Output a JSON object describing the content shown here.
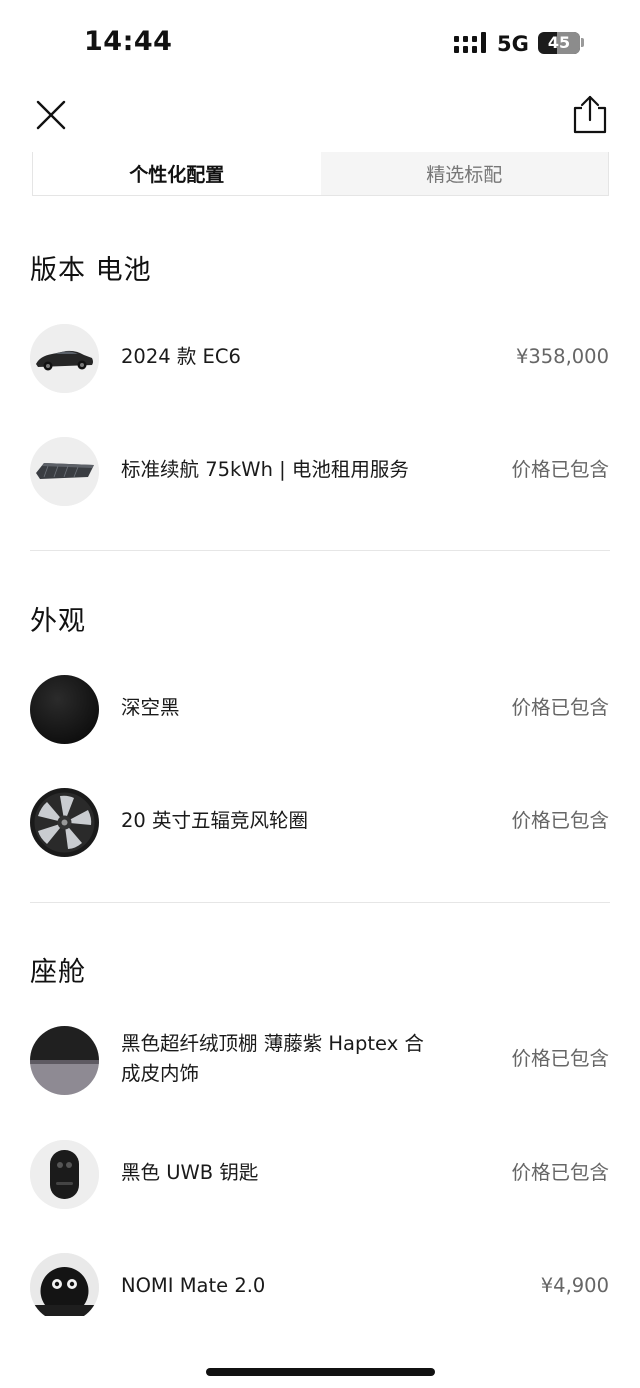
{
  "status_bar": {
    "time": "14:44",
    "network": "5G",
    "battery": "45",
    "battery_level_percent": 45,
    "icons": [
      "signal-icon",
      "battery-icon"
    ]
  },
  "nav": {
    "close_icon": "close-icon",
    "share_icon": "share-icon"
  },
  "tabs": [
    {
      "label": "个性化配置",
      "active": true
    },
    {
      "label": "精选标配",
      "active": false
    }
  ],
  "sections": {
    "version_battery": {
      "title": "版本 电池",
      "items": [
        {
          "name": "2024 款 EC6",
          "price": "¥358,000"
        },
        {
          "name": "标准续航 75kWh | 电池租用服务",
          "price": "价格已包含"
        }
      ]
    },
    "exterior": {
      "title": "外观",
      "items": [
        {
          "name": "深空黑",
          "price": "价格已包含"
        },
        {
          "name": "20 英寸五辐竞风轮圈",
          "price": "价格已包含"
        }
      ]
    },
    "cabin": {
      "title": "座舱",
      "items": [
        {
          "name_line1": "黑色超纤绒顶棚 薄藤紫 Haptex 合",
          "name_line2": "成皮内饰",
          "price": "价格已包含"
        },
        {
          "name": "黑色 UWB 钥匙",
          "price": "价格已包含"
        },
        {
          "name": "NOMI Mate 2.0",
          "price": "¥4,900"
        }
      ]
    }
  },
  "colors": {
    "primary_text": "#1a1a1a",
    "secondary_text": "#666666",
    "divider": "#e6e6e6",
    "tab_inactive_bg": "#f5f5f5"
  }
}
